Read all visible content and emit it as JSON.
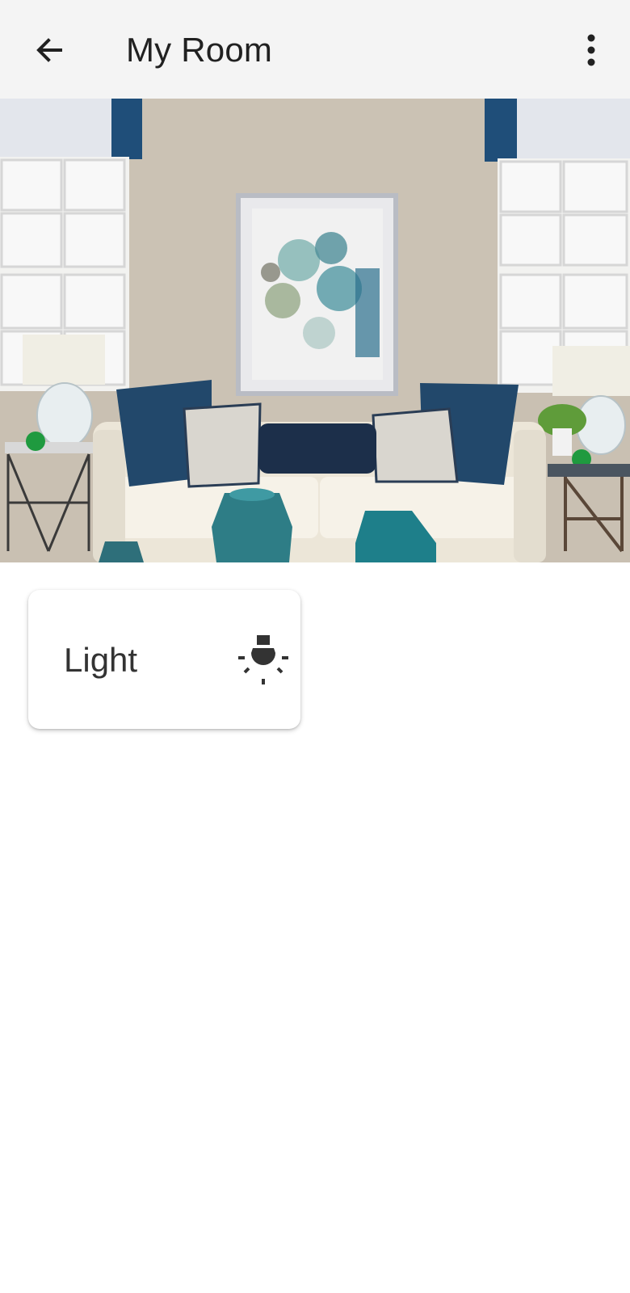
{
  "appbar": {
    "title": "My Room",
    "back_icon": "arrow-back-icon",
    "menu_icon": "more-vert-icon",
    "background": "#f4f4f4"
  },
  "hero": {
    "description_icon": "room-photo"
  },
  "devices": [
    {
      "label": "Light",
      "icon": "lightbulb-icon"
    }
  ],
  "colors": {
    "text_primary": "#212121",
    "card_text": "#333333",
    "accent_teal": "#1e7f8a",
    "accent_navy": "#21496f"
  }
}
